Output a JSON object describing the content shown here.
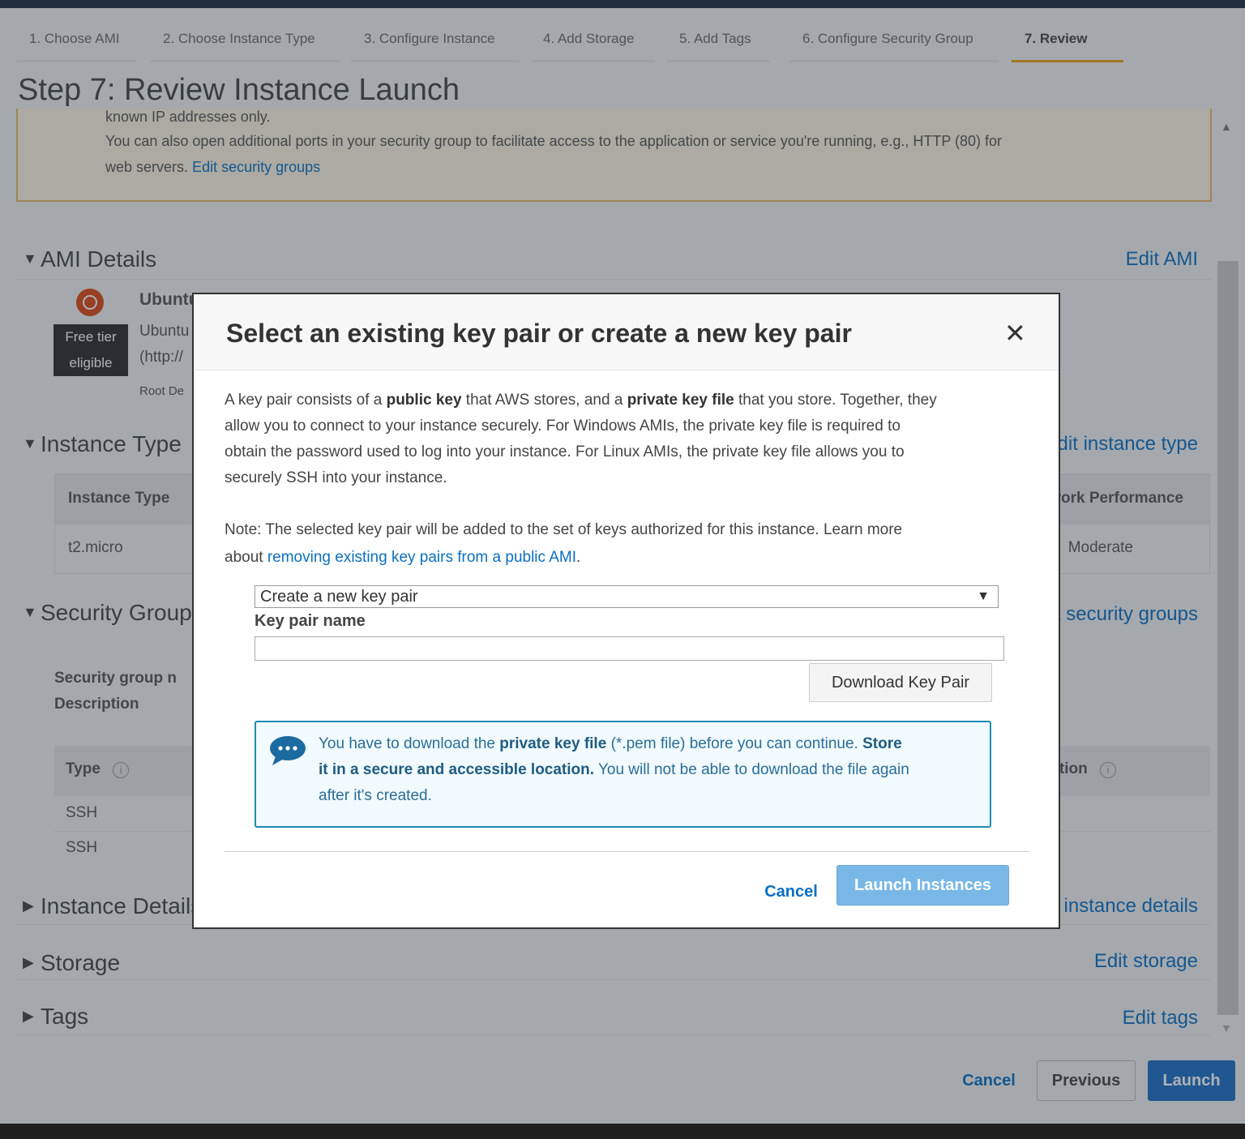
{
  "steps": [
    {
      "label": "1. Choose AMI"
    },
    {
      "label": "2. Choose Instance Type"
    },
    {
      "label": "3. Configure Instance"
    },
    {
      "label": "4. Add Storage"
    },
    {
      "label": "5. Add Tags"
    },
    {
      "label": "6. Configure Security Group"
    },
    {
      "label": "7. Review"
    }
  ],
  "page": {
    "title": "Step 7: Review Instance Launch",
    "warning": {
      "line1": "known IP addresses only.",
      "line2": "You can also open additional ports in your security group to facilitate access to the application or service you're running, e.g., HTTP (80) for",
      "line3_prefix": "web servers.",
      "line3_link": "Edit security groups"
    },
    "sections": {
      "ami": {
        "title": "AMI Details",
        "edit": "Edit AMI"
      },
      "instance_type": {
        "title": "Instance Type",
        "edit": "Edit instance type"
      },
      "security_groups": {
        "title": "Security Groups",
        "edit": "Edit security groups"
      },
      "instance_details": {
        "title": "Instance Details",
        "edit": "Edit instance details"
      },
      "storage": {
        "title": "Storage",
        "edit": "Edit storage"
      },
      "tags": {
        "title": "Tags",
        "edit": "Edit tags"
      }
    },
    "ami": {
      "name": "Ubuntu",
      "desc": "Ubuntu",
      "url": "(http://",
      "root": "Root De",
      "free_tier_line1": "Free tier",
      "free_tier_line2": "eligible"
    },
    "instance_table": {
      "headers": [
        "Instance Type",
        "Network Performance"
      ],
      "row": [
        "t2.micro",
        "Moderate"
      ]
    },
    "security": {
      "group_label": "Security group n",
      "desc_label": "Description",
      "headers": [
        "Type",
        "Description"
      ],
      "rows": [
        "SSH",
        "SSH"
      ]
    },
    "buttons": {
      "cancel": "Cancel",
      "previous": "Previous",
      "launch": "Launch"
    }
  },
  "modal": {
    "title": "Select an existing key pair or create a new key pair",
    "para1": {
      "l1_a": "A key pair consists of a ",
      "l1_b": "public key",
      "l1_c": " that AWS stores, and a ",
      "l1_d": "private key file",
      "l1_e": " that you store. Together, they",
      "l2": "allow you to connect to your instance securely. For Windows AMIs, the private key file is required to",
      "l3": "obtain the password used to log into your instance. For Linux AMIs, the private key file allows you to",
      "l4": "securely SSH into your instance."
    },
    "note": {
      "l1": "Note: The selected key pair will be added to the set of keys authorized for this instance. Learn more",
      "l2_prefix": "about",
      "l2_link": "removing existing key pairs from a public AMI",
      "l2_suffix": "."
    },
    "select_value": "Create a new key pair",
    "key_name_label": "Key pair name",
    "key_name_value": "",
    "download_label": "Download Key Pair",
    "info": {
      "l1_a": "You have to download the ",
      "l1_b": "private key file",
      "l1_c": " (*.pem file) before you can continue. ",
      "l1_d": "Store",
      "l2_a": "it in a secure and accessible location.",
      "l2_b": " You will not be able to download the file again",
      "l3": "after it's created."
    },
    "cancel_label": "Cancel",
    "launch_label": "Launch Instances"
  },
  "colors": {
    "accent": "#0a6fc2",
    "launch_primary": "#1d6fc4",
    "launch_disabled": "#79b8e6",
    "info_border": "#1b8bb2",
    "warning_border": "#e8b86a"
  }
}
